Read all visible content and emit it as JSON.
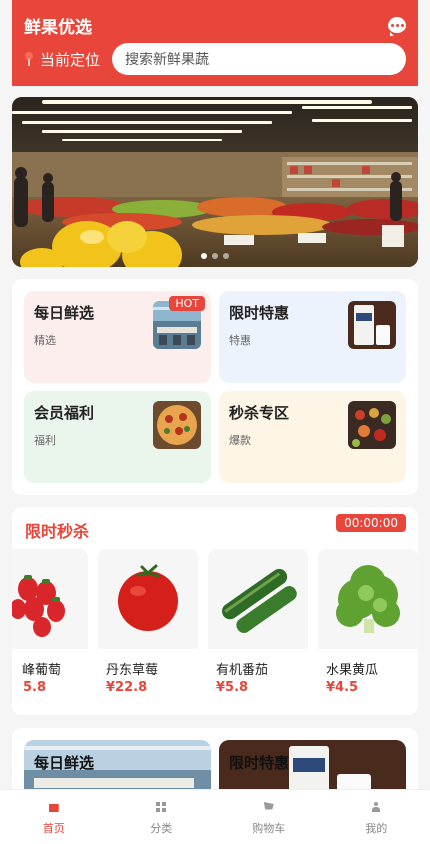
{
  "header": {
    "title": "鲜果优选",
    "location_label": "当前定位",
    "search_placeholder": "搜索新鲜果蔬",
    "bg_color": "#e8463a"
  },
  "banner": {
    "slides": 3,
    "active_index": 0
  },
  "categories": [
    {
      "title": "每日鲜选",
      "subtitle": "精选",
      "badge": "HOT",
      "bg": "#fdeeee"
    },
    {
      "title": "限时特惠",
      "subtitle": "特惠",
      "bg": "#edf3fd"
    },
    {
      "title": "会员福利",
      "subtitle": "福利",
      "bg": "#eaf5ec"
    },
    {
      "title": "秒杀专区",
      "subtitle": "爆款",
      "bg": "#fdf5e6"
    }
  ],
  "flash_sale": {
    "title": "限时秒杀",
    "timer": "00:00:00",
    "products": [
      {
        "name": "峰葡萄",
        "price": "5.8"
      },
      {
        "name": "丹东草莓",
        "price": "¥22.8"
      },
      {
        "name": "有机番茄",
        "price": "¥5.8"
      },
      {
        "name": "水果黄瓜",
        "price": "¥4.5"
      }
    ]
  },
  "section3": {
    "cards": [
      "每日鲜选",
      "限时特惠"
    ]
  },
  "tabbar": [
    {
      "label": "首页",
      "icon": "home-icon",
      "active": true
    },
    {
      "label": "分类",
      "icon": "grid-icon",
      "active": false
    },
    {
      "label": "购物车",
      "icon": "cart-icon",
      "active": false
    },
    {
      "label": "我的",
      "icon": "user-icon",
      "active": false
    }
  ]
}
